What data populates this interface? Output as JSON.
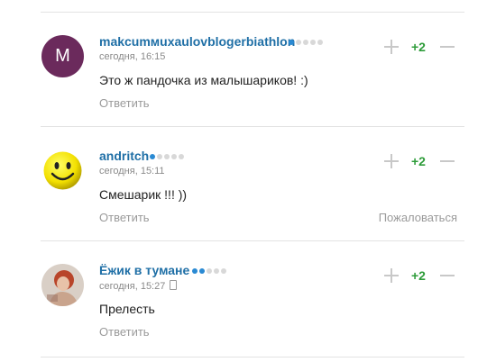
{
  "comments": [
    {
      "avatar_letter": "M",
      "avatar_color": "#6b2a5c",
      "username": "makcumмuxaulovblogerbiathlon",
      "rank_filled": 1,
      "time": "сегодня, 16:15",
      "text": "Это ж пандочка из малышариков! :)",
      "reply_label": "Ответить",
      "score": "+2"
    },
    {
      "avatar_icon": "smiley-face-icon",
      "username": "andritch",
      "rank_filled": 1,
      "time": "сегодня, 15:11",
      "text": "Смешарик !!! ))",
      "reply_label": "Ответить",
      "complain_label": "Пожаловаться",
      "score": "+2"
    },
    {
      "avatar_icon": "photo-avatar",
      "username": "Ёжик в тумане",
      "rank_filled": 2,
      "time": "сегодня, 15:27",
      "time_icon": "mobile-phone-icon",
      "text": "Прелесть",
      "reply_label": "Ответить",
      "score": "+2"
    }
  ],
  "colors": {
    "username": "#1f6fa6",
    "score_positive": "#2e9c3a",
    "muted": "#9a9a9a",
    "rank_on": "#2a8ad3"
  }
}
